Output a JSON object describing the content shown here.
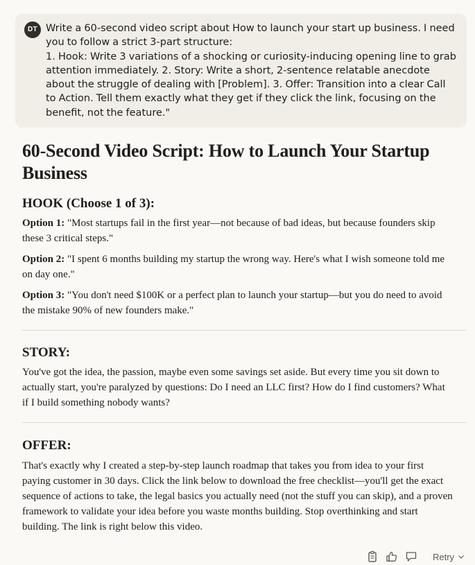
{
  "user_message": {
    "avatar_initials": "DT",
    "text": "Write a 60-second video script about How to launch your start up business. I need you to follow a strict 3-part structure:\n1. Hook: Write 3 variations of a shocking or curiosity-inducing opening line to grab attention immediately. 2. Story: Write a short, 2-sentence relatable anecdote about the struggle of dealing with [Problem]. 3. Offer: Transition into a clear Call to Action. Tell them exactly what they get if they click the link, focusing on the benefit, not the feature.\""
  },
  "response": {
    "title": "60-Second Video Script: How to Launch Your Startup Business",
    "hook": {
      "heading": "HOOK (Choose 1 of 3):",
      "options": [
        {
          "label": "Option 1:",
          "text": " \"Most startups fail in the first year—not because of bad ideas, but because founders skip these 3 critical steps.\""
        },
        {
          "label": "Option 2:",
          "text": " \"I spent 6 months building my startup the wrong way. Here's what I wish someone told me on day one.\""
        },
        {
          "label": "Option 3:",
          "text": " \"You don't need $100K or a perfect plan to launch your startup—but you do need to avoid the mistake 90% of new founders make.\""
        }
      ]
    },
    "story": {
      "heading": "STORY:",
      "text": "You've got the idea, the passion, maybe even some savings set aside. But every time you sit down to actually start, you're paralyzed by questions: Do I need an LLC first? How do I find customers? What if I build something nobody wants?"
    },
    "offer": {
      "heading": "OFFER:",
      "text": "That's exactly why I created a step-by-step launch roadmap that takes you from idea to your first paying customer in 30 days. Click the link below to download the free checklist—you'll get the exact sequence of actions to take, the legal basics you actually need (not the stuff you can skip), and a proven framework to validate your idea before you waste months building. Stop overthinking and start building. The link is right below this video."
    }
  },
  "actions": {
    "icons": [
      "copy-icon",
      "thumbs-up-icon",
      "thumbs-down-icon"
    ],
    "retry_label": "Retry"
  }
}
